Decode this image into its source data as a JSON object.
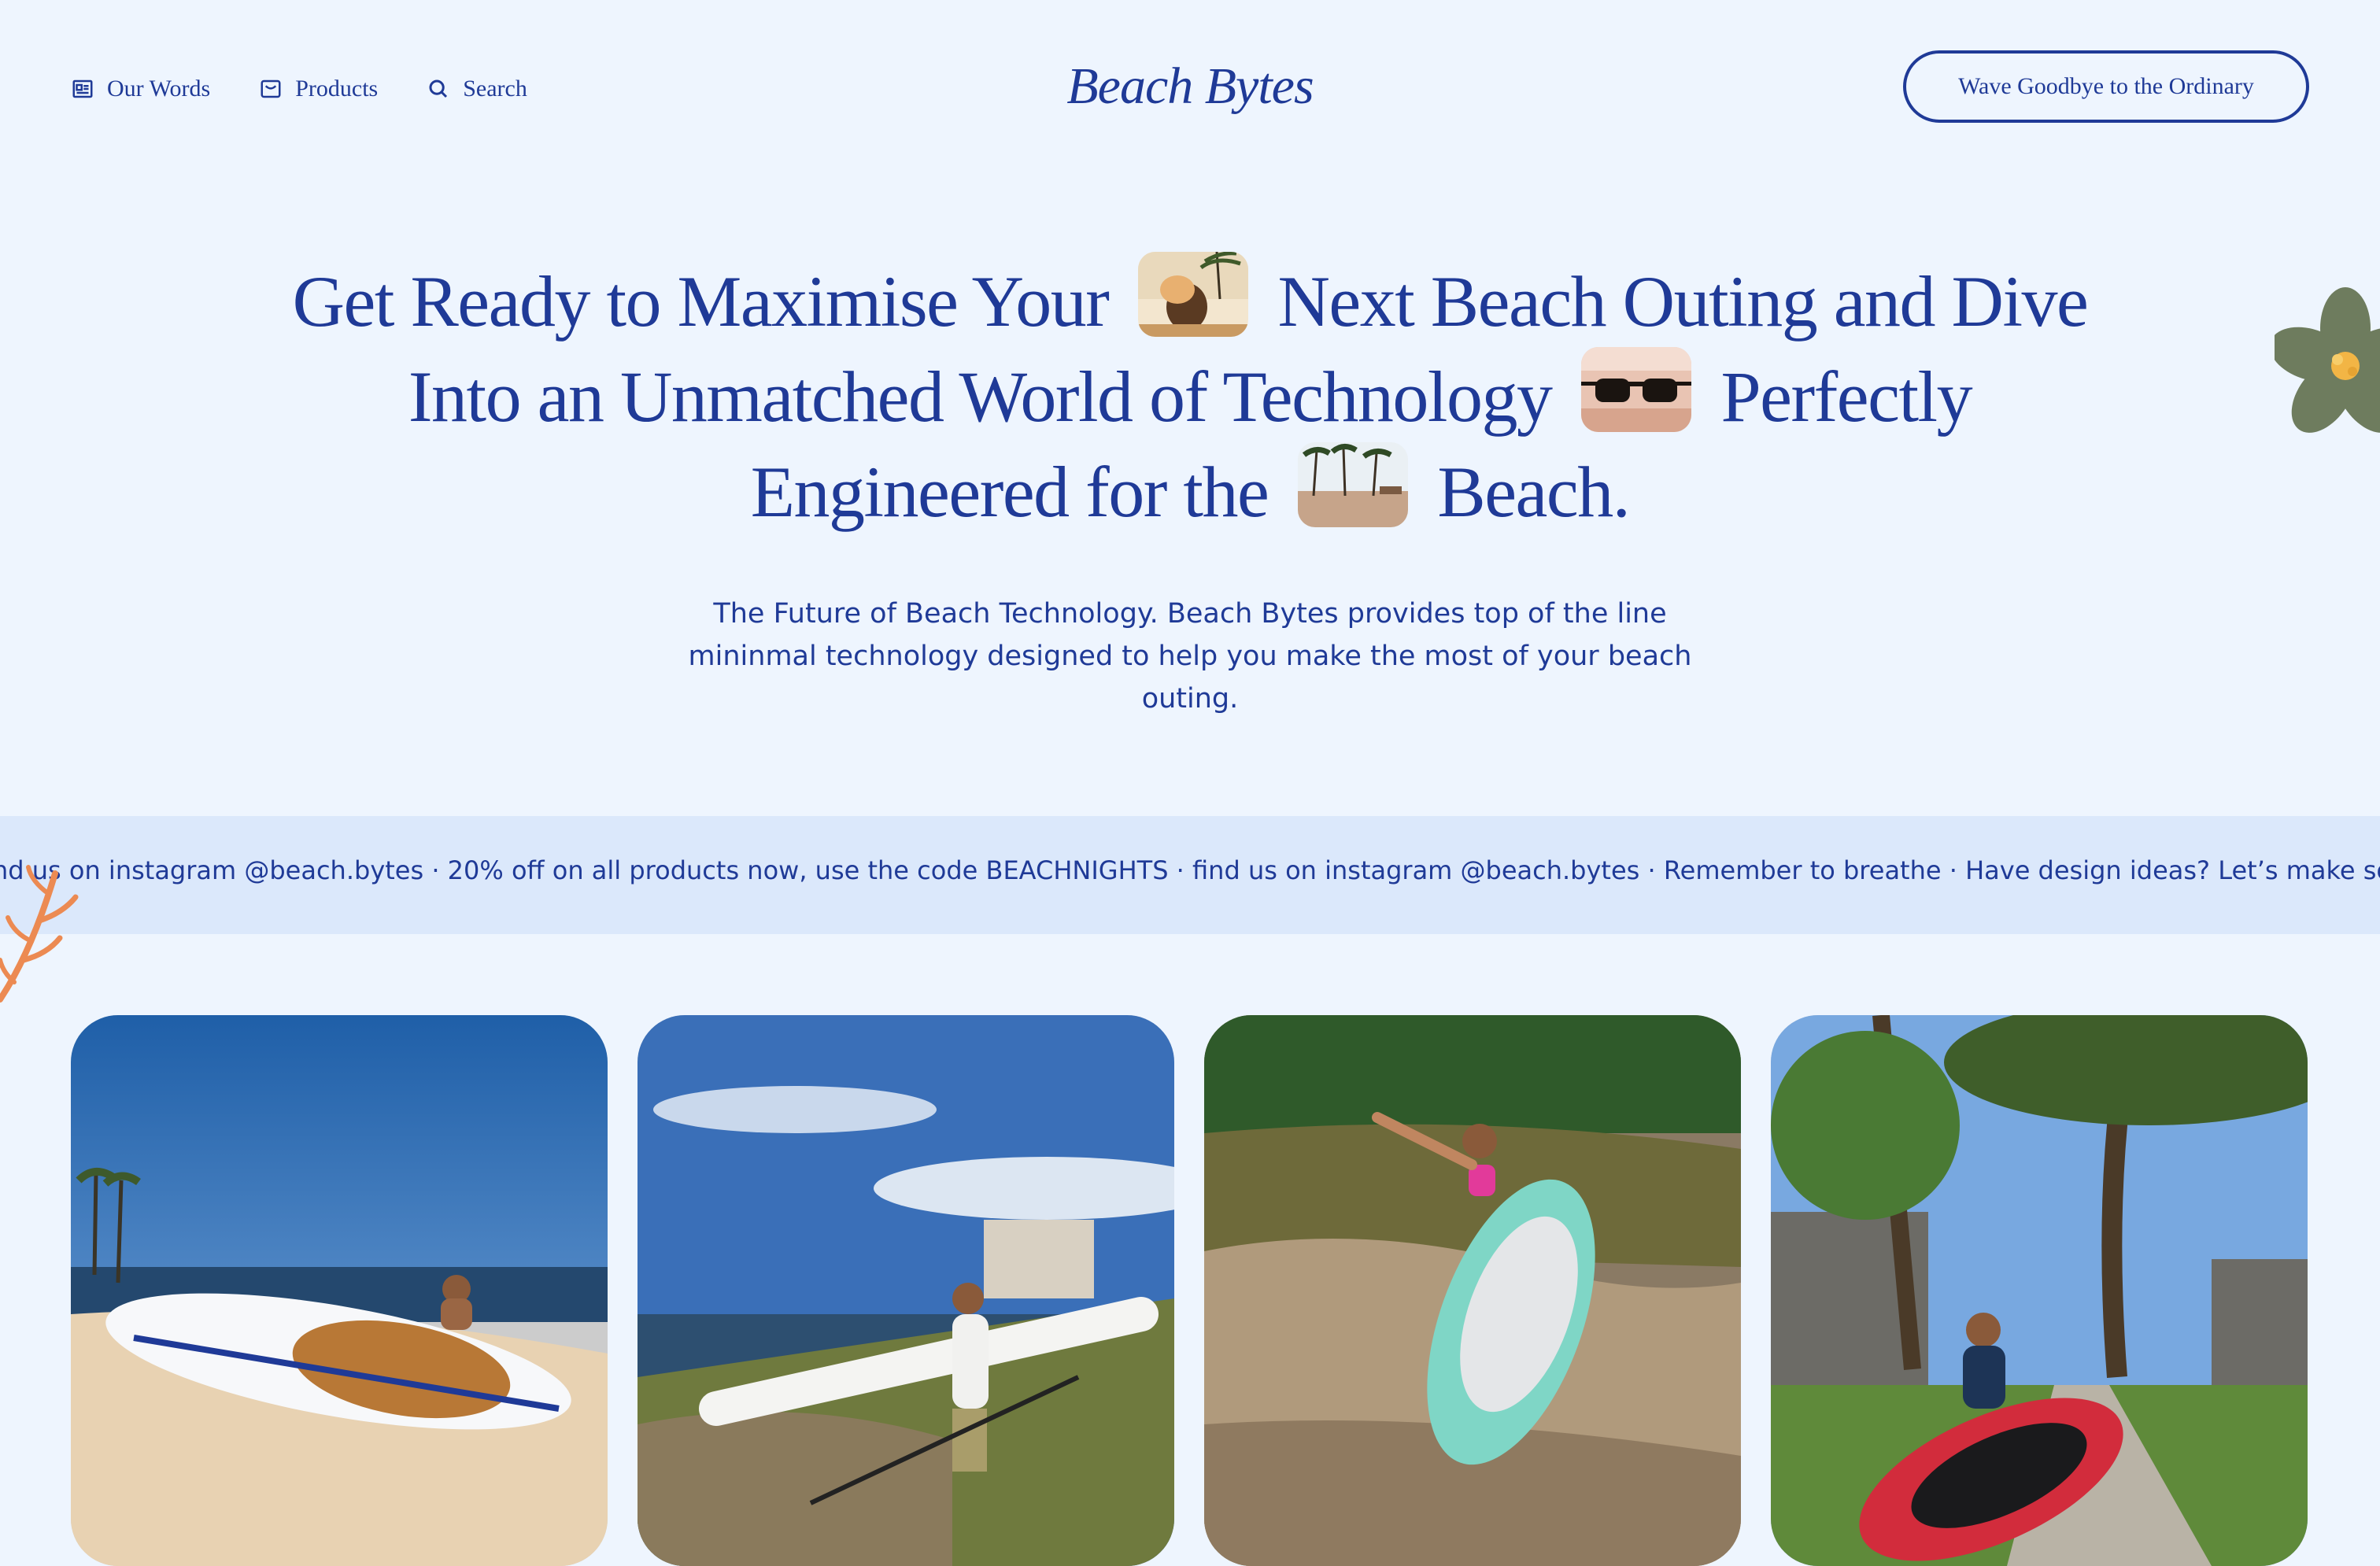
{
  "nav": {
    "items": [
      {
        "label": "Our Words",
        "icon": "newspaper-icon"
      },
      {
        "label": "Products",
        "icon": "inbox-icon"
      },
      {
        "label": "Search",
        "icon": "search-icon"
      }
    ],
    "brand": "Beach Bytes",
    "cta": "Wave Goodbye to the Ordinary"
  },
  "hero": {
    "line1a": "Get Ready to Maximise Your",
    "line1b": "Next Beach Outing and Dive",
    "line2a": "Into an Unmatched World of Technology",
    "line2b": "Perfectly",
    "line3a": "Engineered for the",
    "line3b": "Beach.",
    "subtitle": "The Future of Beach Technology. Beach Bytes provides top of the line mininmal technology designed to help you make the most of your beach outing."
  },
  "ticker": {
    "text": "nd us on instagram @beach.bytes · 20% off on all products now, use the code BEACHNIGHTS · find us on instagram @beach.bytes · Remember to breathe · Have design ideas? Let’s make something"
  },
  "colors": {
    "background": "#eef5fe",
    "primary": "#1f3a97",
    "ticker_bg": "#dbe8fb",
    "flower": "#6e7c5e",
    "branch": "#ec8a52"
  }
}
